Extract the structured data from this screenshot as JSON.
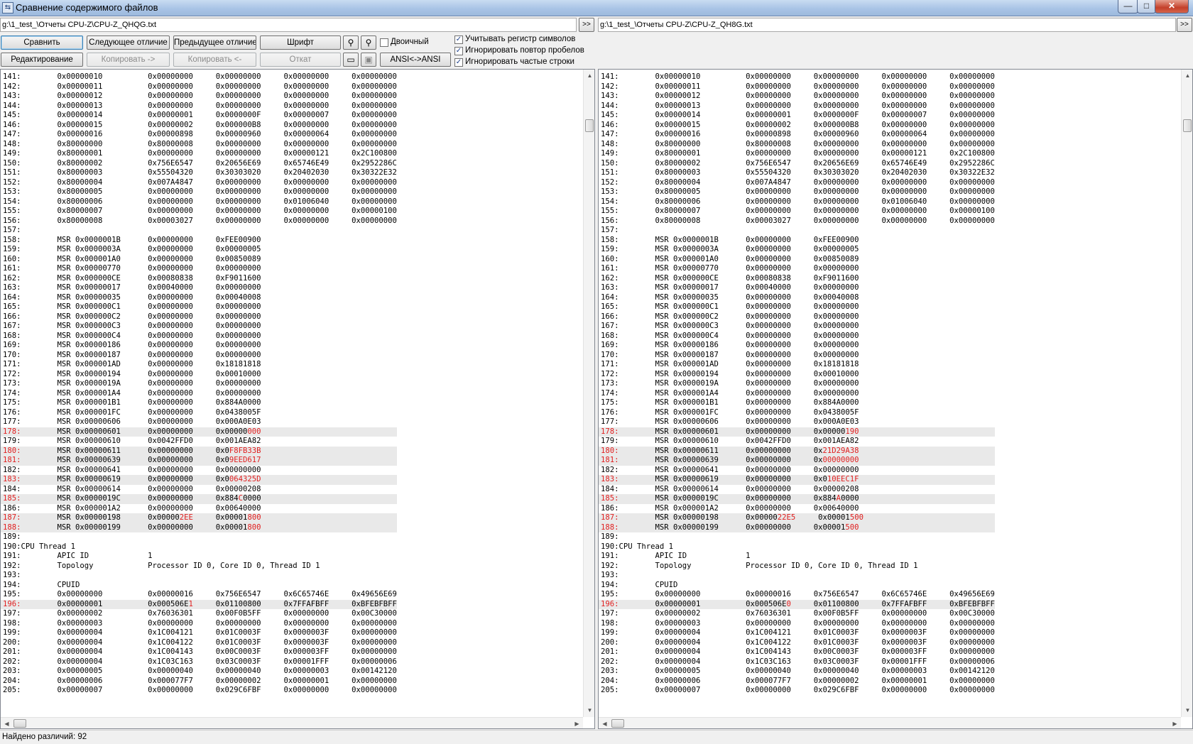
{
  "window": {
    "title": "Сравнение содержимого файлов",
    "icon": "compare-icon",
    "controls": {
      "minimize": "—",
      "maximize": "□",
      "close": "✕"
    }
  },
  "left": {
    "path": "g:\\1_test_\\Отчеты CPU-Z\\CPU-Z_QHQG.txt",
    "arrow_label": ">>"
  },
  "right": {
    "path": "g:\\1_test_\\Отчеты CPU-Z\\CPU-Z_QH8G.txt",
    "arrow_label": ">>"
  },
  "toolbar": {
    "compare": "Сравнить",
    "next_diff": "Следующее отличие",
    "prev_diff": "Предыдущее отличие",
    "font": "Шрифт",
    "edit": "Редактирование",
    "copy_right": "Копировать ->",
    "copy_left": "Копировать <-",
    "revert": "Откат",
    "ansi": "ANSI<->ANSI",
    "binary_label": "Двоичный",
    "binary_checked": false,
    "icons": {
      "find": "binoculars-icon",
      "find_next": "binoculars-next-icon",
      "view": "window-icon",
      "save": "save-icon"
    }
  },
  "options": [
    {
      "label": "Учитывать регистр символов",
      "checked": true
    },
    {
      "label": "Игнорировать повтор пробелов",
      "checked": true
    },
    {
      "label": "Игнорировать частые строки",
      "checked": true
    }
  ],
  "status": {
    "text": "Найдено различий: 92"
  },
  "colors": {
    "diff_text": "#e02020",
    "diff_row_bg": "#e9e9e9",
    "title_gradient": "#a9c4e6"
  },
  "content": {
    "common": [
      {
        "n": "141",
        "t": "        0x00000010          0x00000000     0x00000000     0x00000000     0x00000000"
      },
      {
        "n": "142",
        "t": "        0x00000011          0x00000000     0x00000000     0x00000000     0x00000000"
      },
      {
        "n": "143",
        "t": "        0x00000012          0x00000000     0x00000000     0x00000000     0x00000000"
      },
      {
        "n": "144",
        "t": "        0x00000013          0x00000000     0x00000000     0x00000000     0x00000000"
      },
      {
        "n": "145",
        "t": "        0x00000014          0x00000001     0x0000000F     0x00000007     0x00000000"
      },
      {
        "n": "146",
        "t": "        0x00000015          0x00000002     0x000000B8     0x00000000     0x00000000"
      },
      {
        "n": "147",
        "t": "        0x00000016          0x00000898     0x00000960     0x00000064     0x00000000"
      },
      {
        "n": "148",
        "t": "        0x80000000          0x80000008     0x00000000     0x00000000     0x00000000"
      },
      {
        "n": "149",
        "t": "        0x80000001          0x00000000     0x00000000     0x00000121     0x2C100800"
      },
      {
        "n": "150",
        "t": "        0x80000002          0x756E6547     0x20656E69     0x65746E49     0x2952286C"
      },
      {
        "n": "151",
        "t": "        0x80000003          0x55504320     0x30303020     0x20402030     0x30322E32"
      },
      {
        "n": "152",
        "t": "        0x80000004          0x007A4847     0x00000000     0x00000000     0x00000000"
      },
      {
        "n": "153",
        "t": "        0x80000005          0x00000000     0x00000000     0x00000000     0x00000000"
      },
      {
        "n": "154",
        "t": "        0x80000006          0x00000000     0x00000000     0x01006040     0x00000000"
      },
      {
        "n": "155",
        "t": "        0x80000007          0x00000000     0x00000000     0x00000000     0x00000100"
      },
      {
        "n": "156",
        "t": "        0x80000008          0x00003027     0x00000000     0x00000000     0x00000000"
      },
      {
        "n": "157",
        "t": ""
      },
      {
        "n": "158",
        "t": "        MSR 0x0000001B      0x00000000     0xFEE00900"
      },
      {
        "n": "159",
        "t": "        MSR 0x0000003A      0x00000000     0x00000005"
      },
      {
        "n": "160",
        "t": "        MSR 0x000001A0      0x00000000     0x00850089"
      },
      {
        "n": "161",
        "t": "        MSR 0x00000770      0x00000000     0x00000000"
      },
      {
        "n": "162",
        "t": "        MSR 0x000000CE      0x00080838     0xF9011600"
      },
      {
        "n": "163",
        "t": "        MSR 0x00000017      0x00040000     0x00000000"
      },
      {
        "n": "164",
        "t": "        MSR 0x00000035      0x00000000     0x00040008"
      },
      {
        "n": "165",
        "t": "        MSR 0x000000C1      0x00000000     0x00000000"
      },
      {
        "n": "166",
        "t": "        MSR 0x000000C2      0x00000000     0x00000000"
      },
      {
        "n": "167",
        "t": "        MSR 0x000000C3      0x00000000     0x00000000"
      },
      {
        "n": "168",
        "t": "        MSR 0x000000C4      0x00000000     0x00000000"
      },
      {
        "n": "169",
        "t": "        MSR 0x00000186      0x00000000     0x00000000"
      },
      {
        "n": "170",
        "t": "        MSR 0x00000187      0x00000000     0x00000000"
      },
      {
        "n": "171",
        "t": "        MSR 0x000001AD      0x00000000     0x18181818"
      },
      {
        "n": "172",
        "t": "        MSR 0x00000194      0x00000000     0x00010000"
      },
      {
        "n": "173",
        "t": "        MSR 0x0000019A      0x00000000     0x00000000"
      },
      {
        "n": "174",
        "t": "        MSR 0x000001A4      0x00000000     0x00000000"
      },
      {
        "n": "175",
        "t": "        MSR 0x000001B1      0x00000000     0x884A0000"
      },
      {
        "n": "176",
        "t": "        MSR 0x000001FC      0x00000000     0x0438005F"
      },
      {
        "n": "177",
        "t": "        MSR 0x00000606      0x00000000     0x000A0E03"
      }
    ],
    "left_178_188": [
      {
        "n": "178",
        "d": true,
        "t": "        MSR 0x00000601      0x00000000     0x00000",
        "r": "000",
        "a": ""
      },
      {
        "n": "179",
        "t": "        MSR 0x00000610      0x0042FFD0     0x001AEA82"
      },
      {
        "n": "180",
        "d": true,
        "t": "        MSR 0x00000611      0x00000000     0x0",
        "r": "F8FB33B",
        "a": ""
      },
      {
        "n": "181",
        "d": true,
        "t": "        MSR 0x00000639      0x00000000     0x0",
        "r": "9EED617",
        "a": ""
      },
      {
        "n": "182",
        "t": "        MSR 0x00000641      0x00000000     0x00000000"
      },
      {
        "n": "183",
        "d": true,
        "t": "        MSR 0x00000619      0x00000000     0x0",
        "r": "064325D",
        "a": ""
      },
      {
        "n": "184",
        "t": "        MSR 0x00000614      0x00000000     0x00000208"
      },
      {
        "n": "185",
        "d": true,
        "t": "        MSR 0x0000019C      0x00000000     0x884",
        "r": "C",
        "a": "0000"
      },
      {
        "n": "186",
        "t": "        MSR 0x000001A2      0x00000000     0x00640000"
      },
      {
        "n": "187",
        "d": true,
        "t": "        MSR 0x00000198      0x00000",
        "r": "2EE",
        "a": "     0x00001",
        "r2": "800"
      },
      {
        "n": "188",
        "d": true,
        "t": "        MSR 0x00000199      0x00000000     0x00001",
        "r": "800",
        "a": ""
      }
    ],
    "right_178_188": [
      {
        "n": "178",
        "d": true,
        "t": "        MSR 0x00000601      0x00000000     0x00000",
        "r": "190",
        "a": ""
      },
      {
        "n": "179",
        "t": "        MSR 0x00000610      0x0042FFD0     0x001AEA82"
      },
      {
        "n": "180",
        "d": true,
        "t": "        MSR 0x00000611      0x00000000     0x",
        "r": "21D29A38",
        "a": ""
      },
      {
        "n": "181",
        "d": true,
        "t": "        MSR 0x00000639      0x00000000     0x",
        "r": "00000000",
        "a": ""
      },
      {
        "n": "182",
        "t": "        MSR 0x00000641      0x00000000     0x00000000"
      },
      {
        "n": "183",
        "d": true,
        "t": "        MSR 0x00000619      0x00000000     0x0",
        "r": "10EEC1F",
        "a": ""
      },
      {
        "n": "184",
        "t": "        MSR 0x00000614      0x00000000     0x00000208"
      },
      {
        "n": "185",
        "d": true,
        "t": "        MSR 0x0000019C      0x00000000     0x884",
        "r": "A",
        "a": "0000"
      },
      {
        "n": "186",
        "t": "        MSR 0x000001A2      0x00000000     0x00640000"
      },
      {
        "n": "187",
        "d": true,
        "t": "        MSR 0x00000198      0x00000",
        "r": "22E5",
        "a": "     0x00001",
        "r2": "500"
      },
      {
        "n": "188",
        "d": true,
        "t": "        MSR 0x00000199      0x00000000     0x00001",
        "r": "500",
        "a": ""
      }
    ],
    "common_tail": [
      {
        "n": "189",
        "t": ""
      },
      {
        "n": "190",
        "t": "CPU Thread 1"
      },
      {
        "n": "191",
        "t": "        APIC ID             1"
      },
      {
        "n": "192",
        "t": "        Topology            Processor ID 0, Core ID 0, Thread ID 1"
      },
      {
        "n": "193",
        "t": ""
      },
      {
        "n": "194",
        "t": "        CPUID"
      },
      {
        "n": "195",
        "t": "        0x00000000          0x00000016     0x756E6547     0x6C65746E     0x49656E69"
      }
    ],
    "left_196": {
      "n": "196",
      "d": true,
      "t": "        0x00000001          0x000506E",
      "r": "1",
      "a": "     0x01100800     0x7FFAFBFF     0xBFEBFBFF"
    },
    "right_196": {
      "n": "196",
      "d": true,
      "t": "        0x00000001          0x000506E",
      "r": "0",
      "a": "     0x01100800     0x7FFAFBFF     0xBFEBFBFF"
    },
    "common_end": [
      {
        "n": "197",
        "t": "        0x00000002          0x76036301     0x00F0B5FF     0x00000000     0x00C30000"
      },
      {
        "n": "198",
        "t": "        0x00000003          0x00000000     0x00000000     0x00000000     0x00000000"
      },
      {
        "n": "199",
        "t": "        0x00000004          0x1C004121     0x01C0003F     0x0000003F     0x00000000"
      },
      {
        "n": "200",
        "t": "        0x00000004          0x1C004122     0x01C0003F     0x0000003F     0x00000000"
      },
      {
        "n": "201",
        "t": "        0x00000004          0x1C004143     0x00C0003F     0x000003FF     0x00000000"
      },
      {
        "n": "202",
        "t": "        0x00000004          0x1C03C163     0x03C0003F     0x00001FFF     0x00000006"
      }
    ],
    "left_203": {
      "n": "203",
      "t": "        0x00000005          0x00000040     0x00000040     0x00000003     0x00142120"
    },
    "right_203": {
      "n": "203",
      "t": "        0x00000005          0x00000040     0x00000040     0x00000003     0x00142120"
    },
    "tail2": [
      {
        "n": "204",
        "t": "        0x00000006          0x000077F7     0x00000002     0x00000001     0x00000000"
      },
      {
        "n": "205",
        "t": "        0x00000007          0x00000000     0x029C6FBF     0x00000000     0x00000000"
      }
    ]
  }
}
